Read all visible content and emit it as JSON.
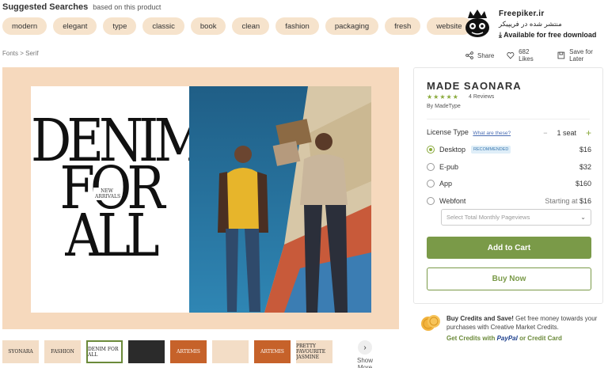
{
  "suggested": {
    "title": "Suggested Searches",
    "subtitle": "based on this product",
    "tags": [
      "modern",
      "elegant",
      "type",
      "classic",
      "book",
      "clean",
      "fashion",
      "packaging",
      "fresh",
      "website"
    ]
  },
  "watermark": {
    "name": "Freepiker.ir",
    "persian": "منتشر شده در فریپیکر",
    "download": "Available for free download"
  },
  "breadcrumb": "Fonts > Serif",
  "actions": {
    "share": "Share",
    "likes": "682 Likes",
    "save": "Save for Later"
  },
  "preview": {
    "headline_1": "DENIM",
    "headline_2": "FOR",
    "headline_3": "ALL",
    "tagline": "NEW ARRIVALS"
  },
  "thumbnails": [
    "SYONARA",
    "FASHION",
    "DENIM FOR ALL",
    "",
    "ARTEMIS",
    "",
    "ARTEMIS",
    "PRETTY FAVOURITE JASMINE"
  ],
  "show_more": "Show More",
  "product": {
    "title": "MADE SAONARA",
    "rating": 5,
    "reviews": "4 Reviews",
    "by": "By MadeType",
    "license_label": "License Type",
    "license_help": "What are these?",
    "seat": "1 seat",
    "options": [
      {
        "name": "Desktop",
        "badge": "RECOMMENDED",
        "price": "$16",
        "selected": true
      },
      {
        "name": "E-pub",
        "price": "$32",
        "selected": false
      },
      {
        "name": "App",
        "price": "$160",
        "selected": false
      },
      {
        "name": "Webfont",
        "price_prefix": "Starting at",
        "price": "$16",
        "selected": false
      }
    ],
    "pageviews_placeholder": "Select Total Monthly Pageviews",
    "add_to_cart": "Add to Cart",
    "buy_now": "Buy Now"
  },
  "credits": {
    "bold": "Buy Credits and Save!",
    "text": "Get free money towards your purchases with Creative Market Credits.",
    "link_1": "Get Credits with",
    "paypal": "PayPal",
    "link_2": "or Credit Card"
  },
  "colors": {
    "accent": "#7a9a48",
    "tag_bg": "#f6e3cc",
    "preview_bg": "#f6d9bd"
  }
}
